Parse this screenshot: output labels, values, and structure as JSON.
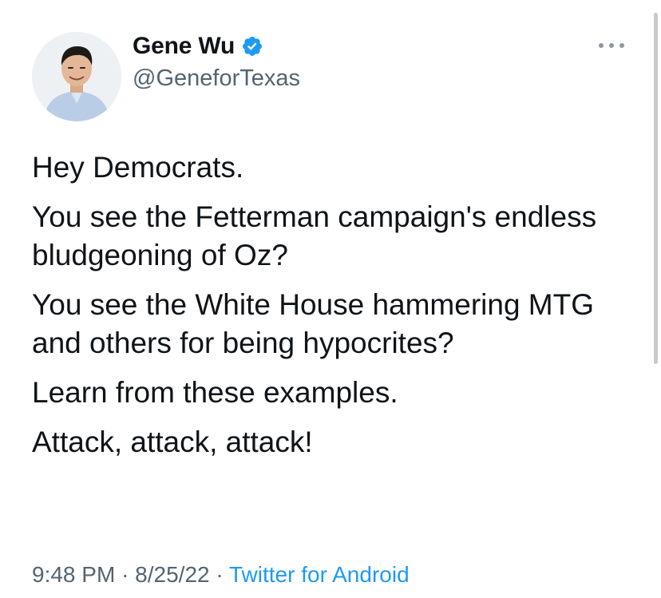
{
  "author": {
    "name": "Gene Wu",
    "handle": "@GeneforTexas",
    "verified": true,
    "avatar_icon": "profile-photo"
  },
  "tweet": {
    "paragraphs": [
      "Hey Democrats.",
      "You see the Fetterman campaign's endless bludgeoning of Oz?",
      "You see the White House hammering MTG and others for being hypocrites?",
      "Learn from these examples.",
      "Attack, attack, attack!"
    ]
  },
  "meta": {
    "time": "9:48 PM",
    "separator": "·",
    "date": "8/25/22",
    "source": "Twitter for Android"
  },
  "colors": {
    "text": "#0f1419",
    "secondary": "#536471",
    "accent": "#1d9bf0"
  }
}
